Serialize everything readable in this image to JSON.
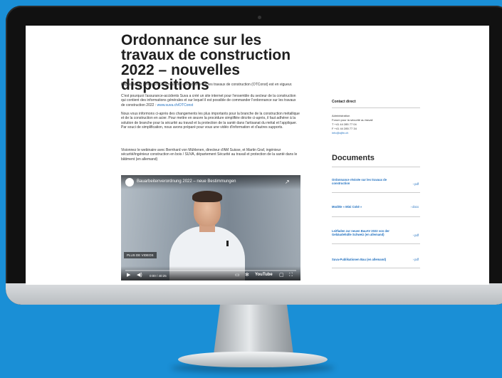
{
  "article": {
    "title": "Ordonnance sur les travaux de construction 2022 – nouvelles dispositions",
    "p1": "Depuis le 1er janvier 2022, la nouvelle ordonnance sur les travaux de construction (OTConst) est en vigueur.",
    "p2": "C'est pourquoi l'assurance-accidents Suva a créé un site internet pour l'ensemble du secteur de la construction qui contient des informations générales et sur lequel il est possible de commander l'ordonnance sur les travaux de construction 2022 :",
    "p2_link": "www.suva.ch/OTConst",
    "p3": "Nous vous informons ci-après des changements les plus importants pour la branche de la construction métallique et de la construction en acier. Pour mettre en œuvre la procédure simplifiée décrite ci-après, il faut adhérer à la solution de branche pour la sécurité au travail et la protection de la santé dans l'artisanat du métal et l'appliquer. Par souci de simplification, nous avons préparé pour vous une vidéo d'information et d'autres supports.",
    "p4": "Visionnez le webinaire avec Bernhard von Mühlenen, directeur d'AM Suisse, et Martin Graf, ingénieur sécurité/ingénieur construction en bois / SUVA, département Sécurité au travail et protection de la santé dans le bâtiment (en allemand)"
  },
  "video": {
    "title": "Bauarbeitenverordnung 2022 – neue Bestimmungen",
    "share": "↗",
    "more_label": "PLUS DE VIDEOS",
    "time": "0:00 / 40:25",
    "youtube": "YouTube"
  },
  "sidebar": {
    "contact_heading": "Contact direct",
    "contact_lines": [
      "Administration",
      "Forum pour la sécurité au travail",
      "T +41 44 285 77 04",
      "F +41 44 285 77 34",
      "info@ajfm.ch"
    ],
    "documents_heading": "Documents",
    "documents": [
      {
        "name": "Ordonnance révisée sur les travaux de construction",
        "type": "› pdf"
      },
      {
        "name": "Modèle « Mini Coké »",
        "type": "› docx"
      },
      {
        "name": "Leitfaden zur neuen BauAV 2022 von der Gebäudehülle Schweiz (en allemand)",
        "type": "› pdf"
      },
      {
        "name": "Suva-Publikationen Bau (en allemand)",
        "type": "› pdf"
      }
    ]
  },
  "colors": {
    "background": "#1a8fd6",
    "link": "#1f6fbf"
  }
}
